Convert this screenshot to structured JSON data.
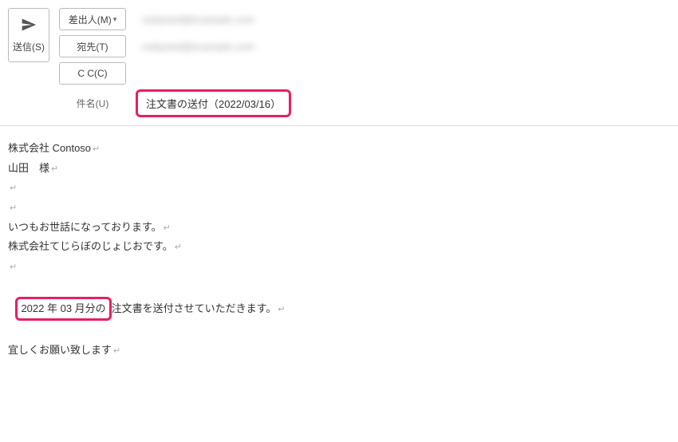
{
  "header": {
    "send_label": "送信(S)",
    "from_label": "差出人(M)",
    "to_label": "宛先(T)",
    "cc_label": "C C(C)",
    "subject_label": "件名(U)",
    "from_value": "redacted@example.com",
    "to_value": "redacted@example.com",
    "subject_value": "注文書の送付（2022/03/16）"
  },
  "body": {
    "line1": "株式会社 Contoso",
    "line2": "山田　様",
    "line3": "",
    "line4": "",
    "line5": "いつもお世話になっております。",
    "line6": "株式会社てじらぼのじょじおです。",
    "line7": "",
    "highlight_text": "2022 年 03 月分の",
    "line8_rest": "注文書を送付させていただきます。",
    "line9": "宜しくお願い致します"
  },
  "highlight_color": "#e91e63"
}
